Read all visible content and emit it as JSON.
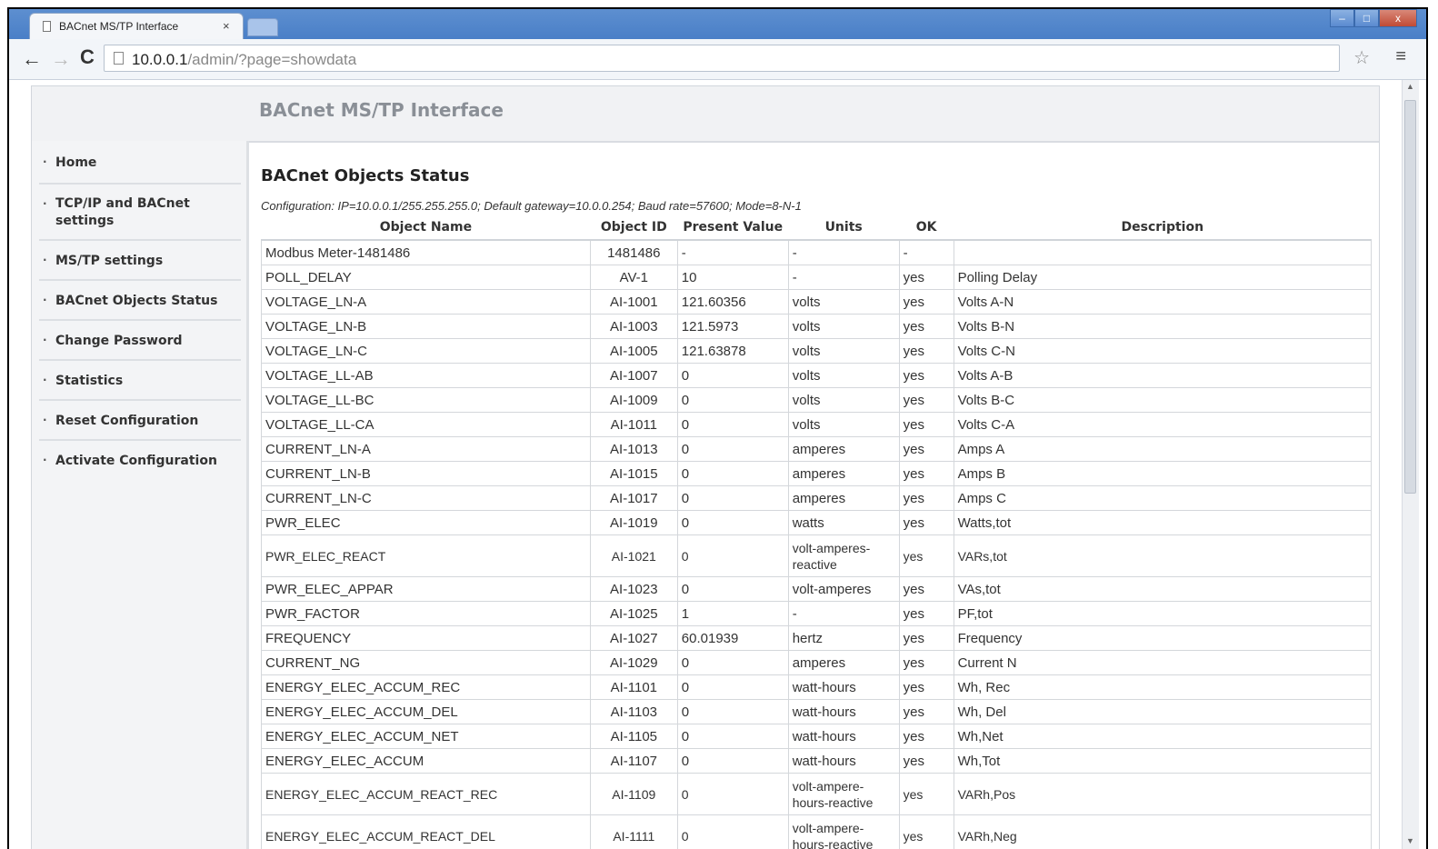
{
  "browser": {
    "tab_title": "BACnet MS/TP Interface",
    "tab_close": "×",
    "url_host": "10.0.0.1",
    "url_path": "/admin/?page=showdata",
    "window_buttons": {
      "minimize": "–",
      "maximize": "□",
      "close": "x"
    }
  },
  "page": {
    "title": "BACnet MS/TP Interface",
    "section_title": "BACnet Objects Status",
    "config_line": "Configuration: IP=10.0.0.1/255.255.255.0; Default gateway=10.0.0.254; Baud rate=57600; Mode=8-N-1"
  },
  "sidebar": {
    "items": [
      {
        "label": "Home"
      },
      {
        "label": "TCP/IP and BACnet settings"
      },
      {
        "label": "MS/TP settings"
      },
      {
        "label": "BACnet Objects Status"
      },
      {
        "label": "Change Password"
      },
      {
        "label": "Statistics"
      },
      {
        "label": "Reset Configuration"
      },
      {
        "label": "Activate Configuration"
      }
    ]
  },
  "table": {
    "headers": [
      "Object Name",
      "Object ID",
      "Present Value",
      "Units",
      "OK",
      "Description"
    ],
    "rows": [
      [
        "Modbus Meter-1481486",
        "1481486",
        "-",
        "-",
        "-",
        ""
      ],
      [
        "POLL_DELAY",
        "AV-1",
        "10",
        "-",
        "yes",
        "Polling Delay"
      ],
      [
        "VOLTAGE_LN-A",
        "AI-1001",
        "121.60356",
        "volts",
        "yes",
        "Volts A-N"
      ],
      [
        "VOLTAGE_LN-B",
        "AI-1003",
        "121.5973",
        "volts",
        "yes",
        "Volts B-N"
      ],
      [
        "VOLTAGE_LN-C",
        "AI-1005",
        "121.63878",
        "volts",
        "yes",
        "Volts C-N"
      ],
      [
        "VOLTAGE_LL-AB",
        "AI-1007",
        "0",
        "volts",
        "yes",
        "Volts A-B"
      ],
      [
        "VOLTAGE_LL-BC",
        "AI-1009",
        "0",
        "volts",
        "yes",
        "Volts B-C"
      ],
      [
        "VOLTAGE_LL-CA",
        "AI-1011",
        "0",
        "volts",
        "yes",
        "Volts C-A"
      ],
      [
        "CURRENT_LN-A",
        "AI-1013",
        "0",
        "amperes",
        "yes",
        "Amps A"
      ],
      [
        "CURRENT_LN-B",
        "AI-1015",
        "0",
        "amperes",
        "yes",
        "Amps B"
      ],
      [
        "CURRENT_LN-C",
        "AI-1017",
        "0",
        "amperes",
        "yes",
        "Amps C"
      ],
      [
        "PWR_ELEC",
        "AI-1019",
        "0",
        "watts",
        "yes",
        "Watts,tot"
      ],
      [
        "PWR_ELEC_REACT",
        "AI-1021",
        "0",
        "volt-amperes-reactive",
        "yes",
        "VARs,tot"
      ],
      [
        "PWR_ELEC_APPAR",
        "AI-1023",
        "0",
        "volt-amperes",
        "yes",
        "VAs,tot"
      ],
      [
        "PWR_FACTOR",
        "AI-1025",
        "1",
        "-",
        "yes",
        "PF,tot"
      ],
      [
        "FREQUENCY",
        "AI-1027",
        "60.01939",
        "hertz",
        "yes",
        "Frequency"
      ],
      [
        "CURRENT_NG",
        "AI-1029",
        "0",
        "amperes",
        "yes",
        "Current N"
      ],
      [
        "ENERGY_ELEC_ACCUM_REC",
        "AI-1101",
        "0",
        "watt-hours",
        "yes",
        "Wh, Rec"
      ],
      [
        "ENERGY_ELEC_ACCUM_DEL",
        "AI-1103",
        "0",
        "watt-hours",
        "yes",
        "Wh, Del"
      ],
      [
        "ENERGY_ELEC_ACCUM_NET",
        "AI-1105",
        "0",
        "watt-hours",
        "yes",
        "Wh,Net"
      ],
      [
        "ENERGY_ELEC_ACCUM",
        "AI-1107",
        "0",
        "watt-hours",
        "yes",
        "Wh,Tot"
      ],
      [
        "ENERGY_ELEC_ACCUM_REACT_REC",
        "AI-1109",
        "0",
        "volt-ampere-hours-reactive",
        "yes",
        "VARh,Pos"
      ],
      [
        "ENERGY_ELEC_ACCUM_REACT_DEL",
        "AI-1111",
        "0",
        "volt-ampere-hours-reactive",
        "yes",
        "VARh,Neg"
      ]
    ]
  }
}
